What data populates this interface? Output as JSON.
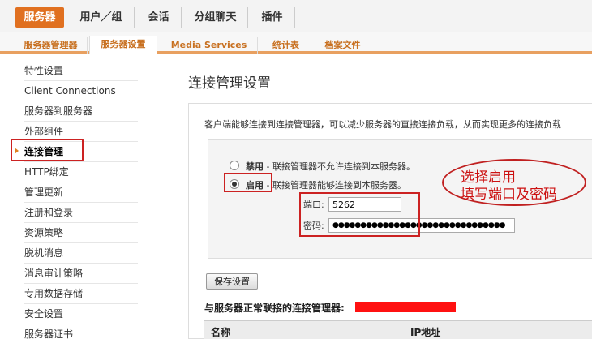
{
  "topnav": {
    "tabs": [
      "服务器",
      "用户／组",
      "会话",
      "分组聊天",
      "插件"
    ],
    "active": 0
  },
  "subnav": {
    "tabs": [
      "服务器管理器",
      "服务器设置",
      "Media Services",
      "统计表",
      "档案文件"
    ],
    "active": 1
  },
  "sidebar": {
    "items": [
      "特性设置",
      "Client Connections",
      "服务器到服务器",
      "外部组件",
      "连接管理",
      "HTTP绑定",
      "管理更新",
      "注册和登录",
      "资源策略",
      "脱机消息",
      "消息审计策略",
      "专用数据存储",
      "安全设置",
      "服务器证书"
    ],
    "active": 4
  },
  "main": {
    "title": "连接管理设置",
    "description": "客户端能够连接到连接管理器，可以减少服务器的直接连接负载，从而实现更多的连接负载",
    "disable_label": "禁用",
    "disable_desc": " - 联接管理器不允许连接到本服务器。",
    "enable_label": "启用",
    "enable_desc": " - 联接管理器能够连接到本服务器。",
    "port_label": "端口:",
    "port_value": "5262",
    "password_label": "密码:",
    "password_value": "●●●●●●●●●●●●●●●●●●●●●●●●●●●●●●●",
    "save_label": "保存设置",
    "connected_title": "与服务器正常联接的连接管理器:",
    "col_name": "名称",
    "col_ip": "IP地址"
  },
  "annotation": {
    "line1": "选择启用",
    "line2": "填写端口及密码"
  },
  "colors": {
    "accent": "#e07020",
    "highlight_red": "#cc2222"
  }
}
